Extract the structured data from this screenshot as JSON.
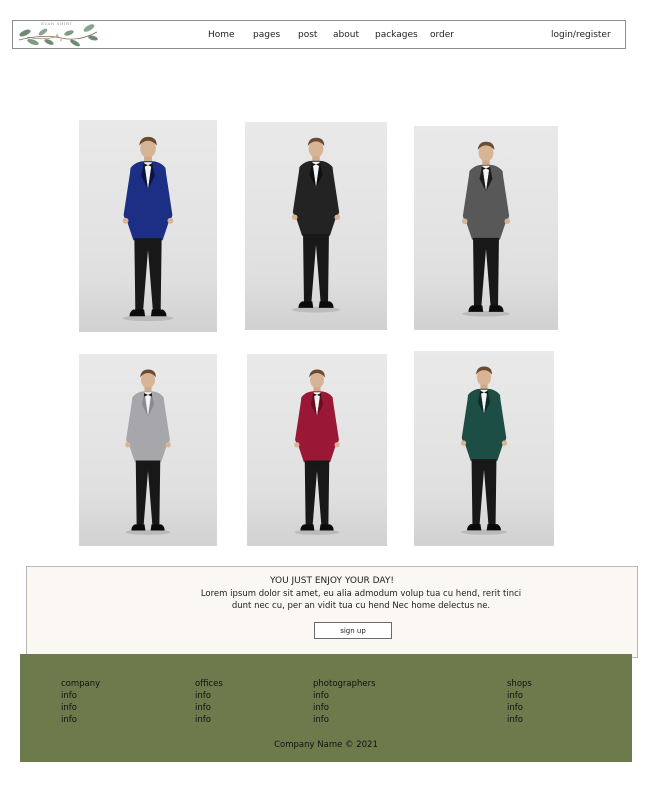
{
  "header": {
    "logo_text": "EVAN SHIRT",
    "nav": [
      {
        "label": "Home"
      },
      {
        "label": "pages"
      },
      {
        "label": "post"
      },
      {
        "label": "about"
      },
      {
        "label": "packages"
      },
      {
        "label": "order"
      }
    ],
    "login_label": "login/register"
  },
  "gallery": {
    "items": [
      {
        "subject": "model-blue-velvet-tuxedo",
        "jacket_color": "#1c2f84",
        "lapel_color": "#0c1540"
      },
      {
        "subject": "model-black-tuxedo",
        "jacket_color": "#232323",
        "lapel_color": "#0f0f0f"
      },
      {
        "subject": "model-charcoal-tuxedo",
        "jacket_color": "#585858",
        "lapel_color": "#1b1b1b"
      },
      {
        "subject": "model-grey-jacket",
        "jacket_color": "#a7a7ab",
        "lapel_color": "#8a8a8e"
      },
      {
        "subject": "model-burgundy-velvet-tuxedo",
        "jacket_color": "#9b1736",
        "lapel_color": "#6b0c22"
      },
      {
        "subject": "model-emerald-velvet-tuxedo",
        "jacket_color": "#1d4e45",
        "lapel_color": "#0e2d27"
      }
    ]
  },
  "promo": {
    "title": "YOU JUST ENJOY YOUR DAY!",
    "body": "Lorem ipsum dolor sit amet, eu alia admodum volup tua cu hend, rerit tinci dunt nec cu, per an vidit tua cu hend Nec home delectus ne.",
    "button_label": "sign up"
  },
  "footer": {
    "columns": [
      {
        "title": "company",
        "items": [
          "info",
          "info",
          "info"
        ]
      },
      {
        "title": "offices",
        "items": [
          "info",
          "info",
          "info"
        ]
      },
      {
        "title": "photographers",
        "items": [
          "info",
          "info",
          "info"
        ]
      },
      {
        "title": "shops",
        "items": [
          "info",
          "info",
          "info"
        ]
      }
    ],
    "copyright": "Company Name © 2021"
  },
  "colors": {
    "footer_bg": "#6c7a4c",
    "promo_bg": "#fbf8f3",
    "header_border": "#8c8c8c"
  }
}
